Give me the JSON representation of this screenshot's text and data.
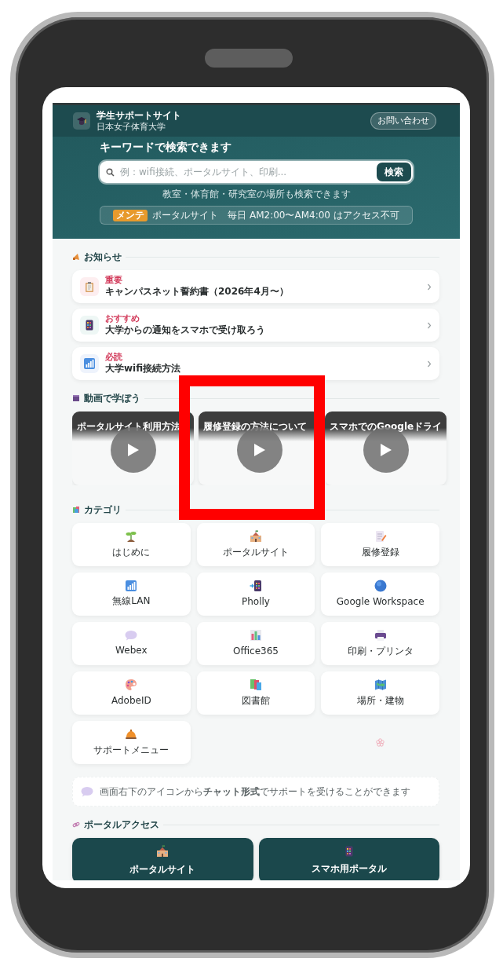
{
  "header": {
    "title": "学生サポートサイト",
    "subtitle": "日本女子体育大学",
    "contact_button": "お問い合わせ"
  },
  "hero": {
    "heading": "キーワードで検索できます",
    "search": {
      "placeholder": "例：wifi接続、ポータルサイト、印刷...",
      "button": "検索"
    },
    "hint": "教室・体育館・研究室の場所も検索できます",
    "maintenance": {
      "tag": "メンテ",
      "text": "ポータルサイト　毎日 AM2:00〜AM4:00 はアクセス不可"
    }
  },
  "notices": {
    "title": "お知らせ",
    "items": [
      {
        "tag": "重要",
        "title": "キャンパスネット誓約書（2026年4月〜）"
      },
      {
        "tag": "おすすめ",
        "title": "大学からの通知をスマホで受け取ろう"
      },
      {
        "tag": "必読",
        "title": "大学wifi接続方法"
      }
    ]
  },
  "videos": {
    "title": "動画で学ぼう",
    "items": [
      {
        "title": "ポータルサイト利用方法"
      },
      {
        "title": "履修登録の方法について"
      },
      {
        "title": "スマホでのGoogleドライ"
      }
    ]
  },
  "categories": {
    "title": "カテゴリ",
    "items": [
      {
        "label": "はじめに"
      },
      {
        "label": "ポータルサイト"
      },
      {
        "label": "履修登録"
      },
      {
        "label": "無線LAN"
      },
      {
        "label": "Pholly"
      },
      {
        "label": "Google Workspace"
      },
      {
        "label": "Webex"
      },
      {
        "label": "Office365"
      },
      {
        "label": "印刷・プリンタ"
      },
      {
        "label": "AdobeID"
      },
      {
        "label": "図書館"
      },
      {
        "label": "場所・建物"
      },
      {
        "label": "サポートメニュー"
      }
    ]
  },
  "chat_hint": "画面右下のアイコンから**チャット形式**でサポートを受けることができます",
  "portal": {
    "title": "ポータルアクセス",
    "buttons": [
      {
        "label": "ポータルサイト"
      },
      {
        "label": "スマホ用ポータル"
      }
    ]
  }
}
